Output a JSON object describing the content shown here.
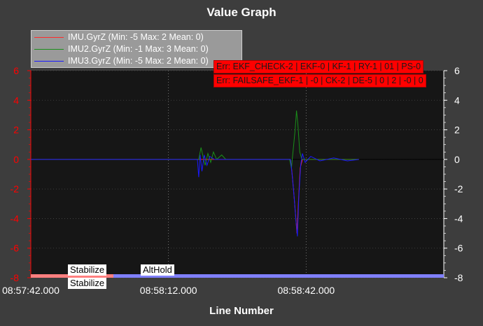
{
  "chart_data": {
    "type": "line",
    "title": "Value Graph",
    "xlabel": "Line Number",
    "ylabel": "",
    "ylim": [
      -8,
      6
    ],
    "yticks": [
      "6",
      "4",
      "2",
      "0",
      "-2",
      "-4",
      "-6",
      "-8"
    ],
    "yticks_right": [
      "6",
      "4",
      "2",
      "0",
      "-2",
      "-4",
      "-6",
      "-8"
    ],
    "xlim": [
      "08:57:42.000",
      "08:59:12.000"
    ],
    "xticks": [
      "08:57:42.000",
      "08:58:12.000",
      "08:58:42.000"
    ],
    "grid": true,
    "legend_position": "top-left",
    "left_axis_color": "#ff0000",
    "right_axis_color": "#ffffff",
    "series": [
      {
        "name": "IMU.GyrZ (Min: -5 Max: 2 Mean: 0)",
        "color": "#ff2a2a",
        "points": [
          [
            "08:57:42.000",
            0
          ],
          [
            "08:58:18.500",
            0
          ],
          [
            "08:58:38.600",
            0
          ],
          [
            "08:58:38.900",
            -0.8
          ],
          [
            "08:58:39.300",
            -2.2
          ],
          [
            "08:58:39.700",
            -3.8
          ],
          [
            "08:58:40.000",
            -5.0
          ],
          [
            "08:58:40.300",
            -3.0
          ],
          [
            "08:58:40.700",
            -0.6
          ],
          [
            "08:58:41.200",
            0
          ],
          [
            "08:58:53.500",
            0
          ]
        ]
      },
      {
        "name": "IMU2.GyrZ (Min: -1 Max: 3 Mean: 0)",
        "color": "#1a8f1a",
        "points": [
          [
            "08:57:42.000",
            0
          ],
          [
            "08:58:18.600",
            0
          ],
          [
            "08:58:19.100",
            0.8
          ],
          [
            "08:58:19.600",
            0.1
          ],
          [
            "08:58:20.000",
            -0.4
          ],
          [
            "08:58:20.600",
            0.4
          ],
          [
            "08:58:21.200",
            -0.2
          ],
          [
            "08:58:21.800",
            0.5
          ],
          [
            "08:58:22.500",
            0
          ],
          [
            "08:58:23.600",
            0.3
          ],
          [
            "08:58:24.500",
            0
          ],
          [
            "08:58:38.400",
            0
          ],
          [
            "08:58:38.800",
            -0.6
          ],
          [
            "08:58:39.000",
            0.1
          ],
          [
            "08:58:39.300",
            1.0
          ],
          [
            "08:58:39.600",
            2.0
          ],
          [
            "08:58:39.900",
            3.3
          ],
          [
            "08:58:40.200",
            2.4
          ],
          [
            "08:58:40.600",
            0.5
          ],
          [
            "08:58:41.100",
            0
          ],
          [
            "08:58:53.500",
            0
          ]
        ]
      },
      {
        "name": "IMU3.GyrZ (Min: -5 Max: 2 Mean: 0)",
        "color": "#1a1aff",
        "points": [
          [
            "08:57:42.000",
            0
          ],
          [
            "08:58:18.300",
            0
          ],
          [
            "08:58:18.600",
            -1.2
          ],
          [
            "08:58:18.900",
            0.3
          ],
          [
            "08:58:19.300",
            -0.8
          ],
          [
            "08:58:19.800",
            0.3
          ],
          [
            "08:58:20.400",
            -0.4
          ],
          [
            "08:58:21.000",
            0.2
          ],
          [
            "08:58:22.000",
            0
          ],
          [
            "08:58:38.600",
            0
          ],
          [
            "08:58:39.000",
            -1.2
          ],
          [
            "08:58:39.400",
            -2.6
          ],
          [
            "08:58:39.800",
            -4.2
          ],
          [
            "08:58:40.100",
            -5.2
          ],
          [
            "08:58:40.400",
            -2.6
          ],
          [
            "08:58:40.800",
            -0.4
          ],
          [
            "08:58:41.200",
            0.4
          ],
          [
            "08:58:41.800",
            -0.2
          ],
          [
            "08:58:43.000",
            0.2
          ],
          [
            "08:58:45.000",
            -0.1
          ],
          [
            "08:58:48.000",
            0.1
          ],
          [
            "08:58:51.000",
            -0.1
          ],
          [
            "08:58:53.500",
            0
          ]
        ]
      }
    ],
    "error_labels": [
      "Err: EKF_CHECK-2 | EKF-0 | KF-1 | RY-1 | 01 | PS-0",
      "Err: FAILSAFE_EKF-1 | -0 | CK-2 | DE-5 | 0 | 2 | -0 | 0"
    ],
    "mode_bands": [
      {
        "label": "Stabilize",
        "start": "08:57:42.000",
        "end": "08:58:00.000",
        "color": "#ff7f7f"
      },
      {
        "label": "AltHold",
        "start": "08:58:00.000",
        "end": "08:59:12.000",
        "color": "#8080ff"
      }
    ],
    "mode_labels_lower": [
      "Stabilize"
    ]
  }
}
